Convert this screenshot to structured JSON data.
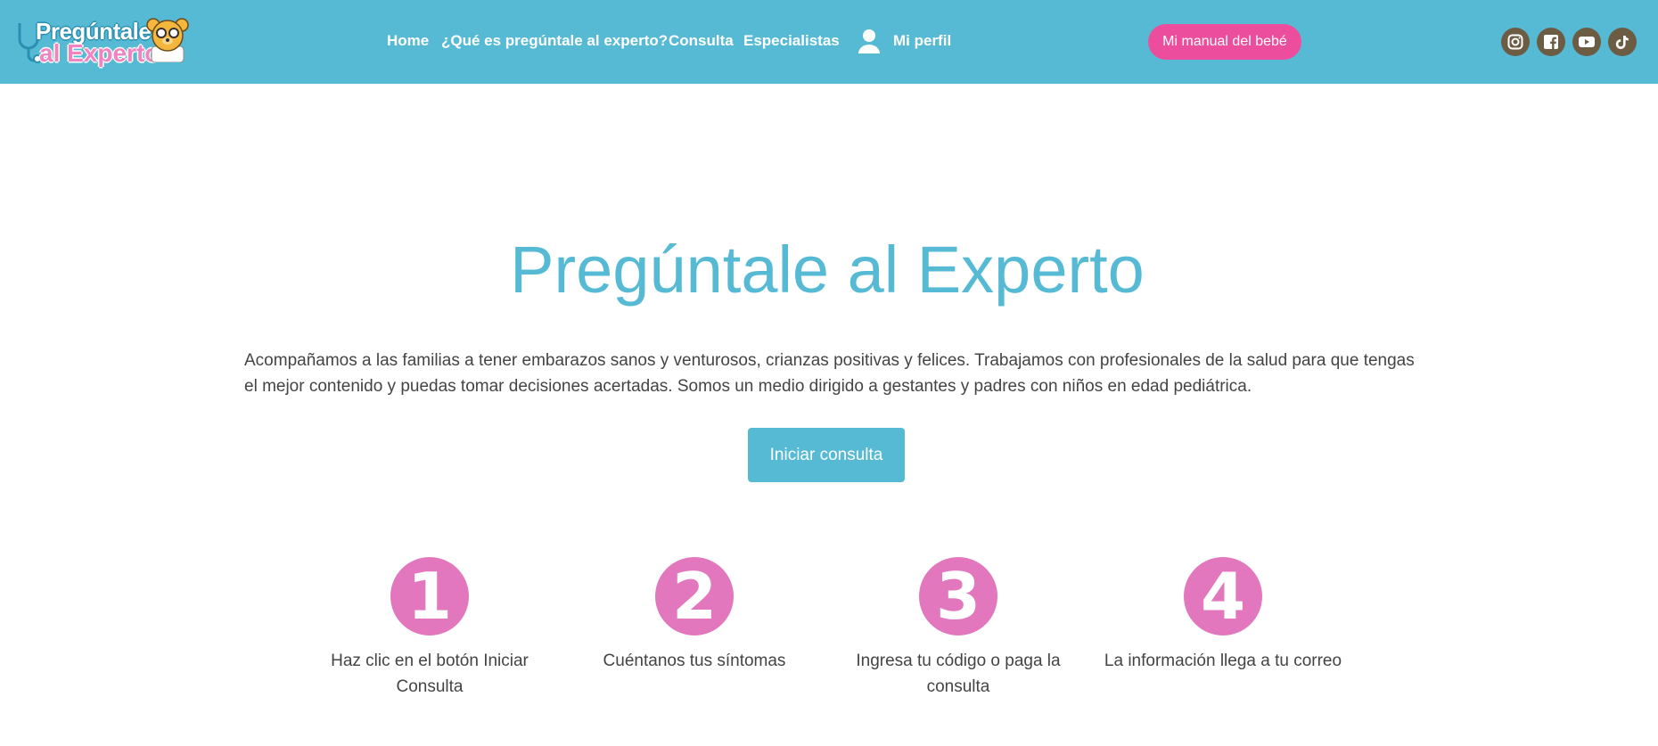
{
  "logo": {
    "line1": "Pregúntale",
    "line2": "al Experto"
  },
  "nav": {
    "home": "Home",
    "about": "¿Qué es pregúntale al experto?",
    "consulta": "Consulta",
    "especialistas": "Especialistas",
    "profile": "Mi perfil"
  },
  "cta_manual": "Mi manual del bebé",
  "social": [
    "instagram-icon",
    "facebook-icon",
    "youtube-icon",
    "tiktok-icon"
  ],
  "hero": {
    "title": "Pregúntale al Experto",
    "intro": "Acompañamos a las familias a tener embarazos sanos y venturosos, crianzas positivas y felices. Trabajamos con profesionales de la salud para que tengas el mejor contenido y puedas tomar decisiones acertadas. Somos un medio dirigido a gestantes y padres con niños en edad pediátrica.",
    "button": "Iniciar consulta"
  },
  "steps": [
    {
      "number": "1",
      "label": "Haz clic en el botón Iniciar Consulta"
    },
    {
      "number": "2",
      "label": "Cuéntanos tus síntomas"
    },
    {
      "number": "3",
      "label": "Ingresa tu código o paga la consulta"
    },
    {
      "number": "4",
      "label": "La información llega a tu correo"
    }
  ],
  "colors": {
    "header": "#56bad4",
    "accent_pink": "#ec4d9c",
    "step_pink": "#e377bd",
    "social": "#6d5c44"
  }
}
